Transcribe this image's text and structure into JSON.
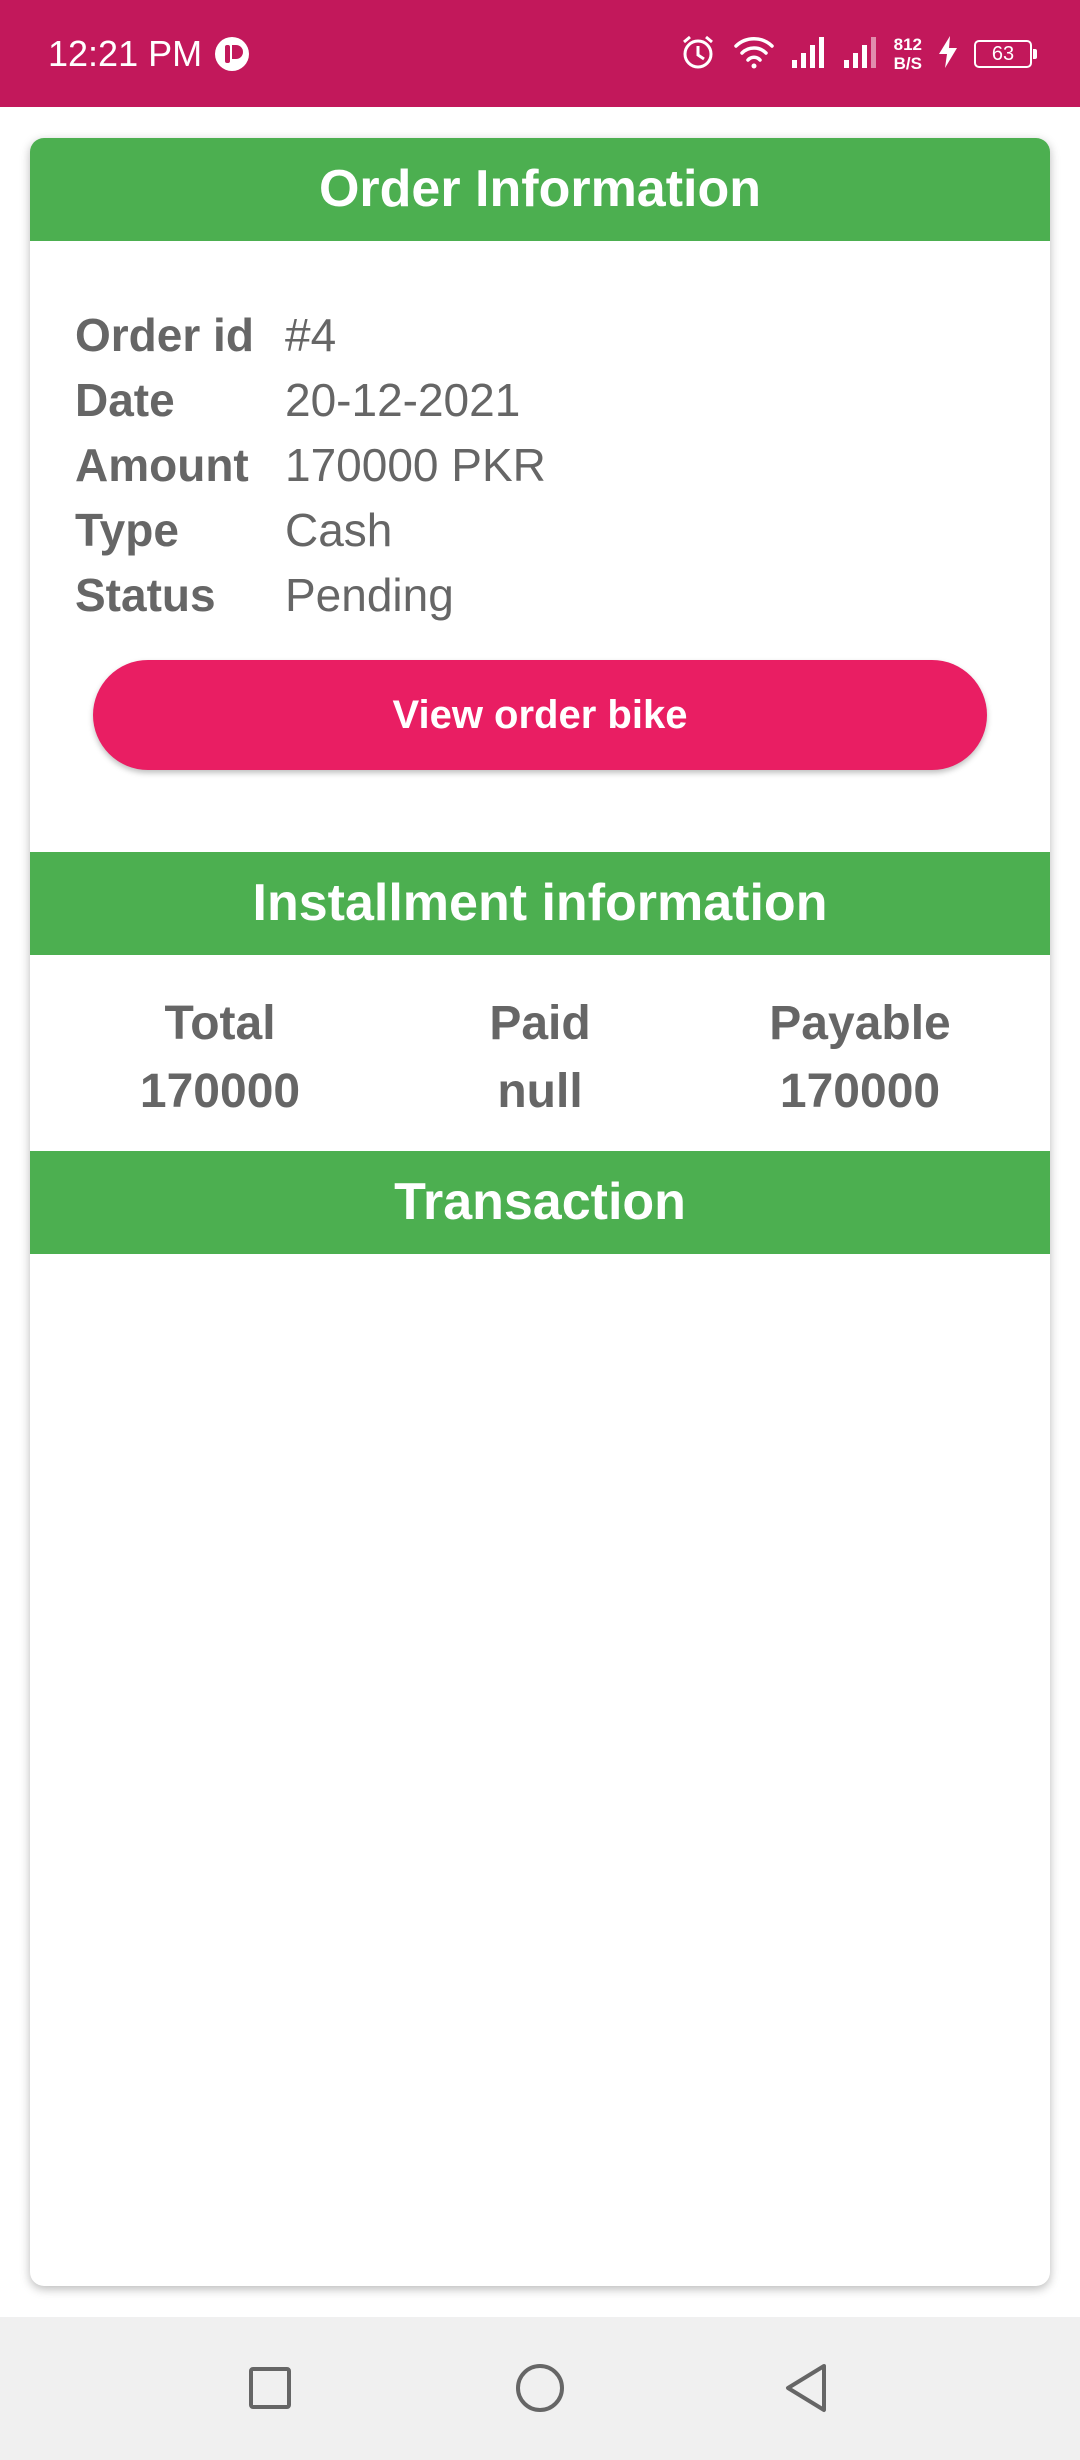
{
  "status_bar": {
    "time": "12:21 PM",
    "net_speed_value": "812",
    "net_speed_unit": "B/S",
    "battery_level": "63",
    "background_color": "#c2185b",
    "icons": [
      "alarm-icon",
      "wifi-icon",
      "signal-icon",
      "signal-icon",
      "charging-icon",
      "battery-icon"
    ]
  },
  "order_info": {
    "header": "Order Information",
    "rows": [
      {
        "label": "Order id",
        "value": "#4"
      },
      {
        "label": "Date",
        "value": "20-12-2021"
      },
      {
        "label": "Amount",
        "value": "170000 PKR"
      },
      {
        "label": "Type",
        "value": "Cash"
      },
      {
        "label": "Status",
        "value": "Pending"
      }
    ],
    "view_button_label": "View order bike",
    "button_color": "#e91e63"
  },
  "installment": {
    "header": "Installment information",
    "columns": [
      {
        "label": "Total",
        "value": "170000"
      },
      {
        "label": "Paid",
        "value": "null"
      },
      {
        "label": "Payable",
        "value": "170000"
      }
    ]
  },
  "transaction": {
    "header": "Transaction"
  },
  "theme": {
    "header_color": "#4caf50",
    "text_color": "#666666"
  },
  "nav_bar": {
    "buttons": [
      "recents-square-icon",
      "home-circle-icon",
      "back-triangle-icon"
    ]
  }
}
